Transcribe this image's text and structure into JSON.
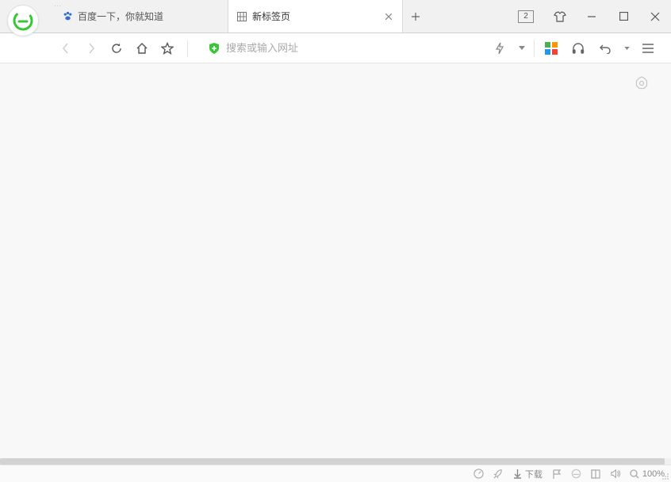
{
  "window": {
    "tab_count_indicator": "2"
  },
  "tabs": [
    {
      "label": "百度一下，你就知道",
      "favicon": "baidu-paw-icon",
      "active": false
    },
    {
      "label": "新标签页",
      "favicon": "grid-icon",
      "active": true
    }
  ],
  "toolbar": {
    "address_placeholder": "搜索或输入网址"
  },
  "statusbar": {
    "download_label": "下载",
    "zoom_label": "100%"
  }
}
